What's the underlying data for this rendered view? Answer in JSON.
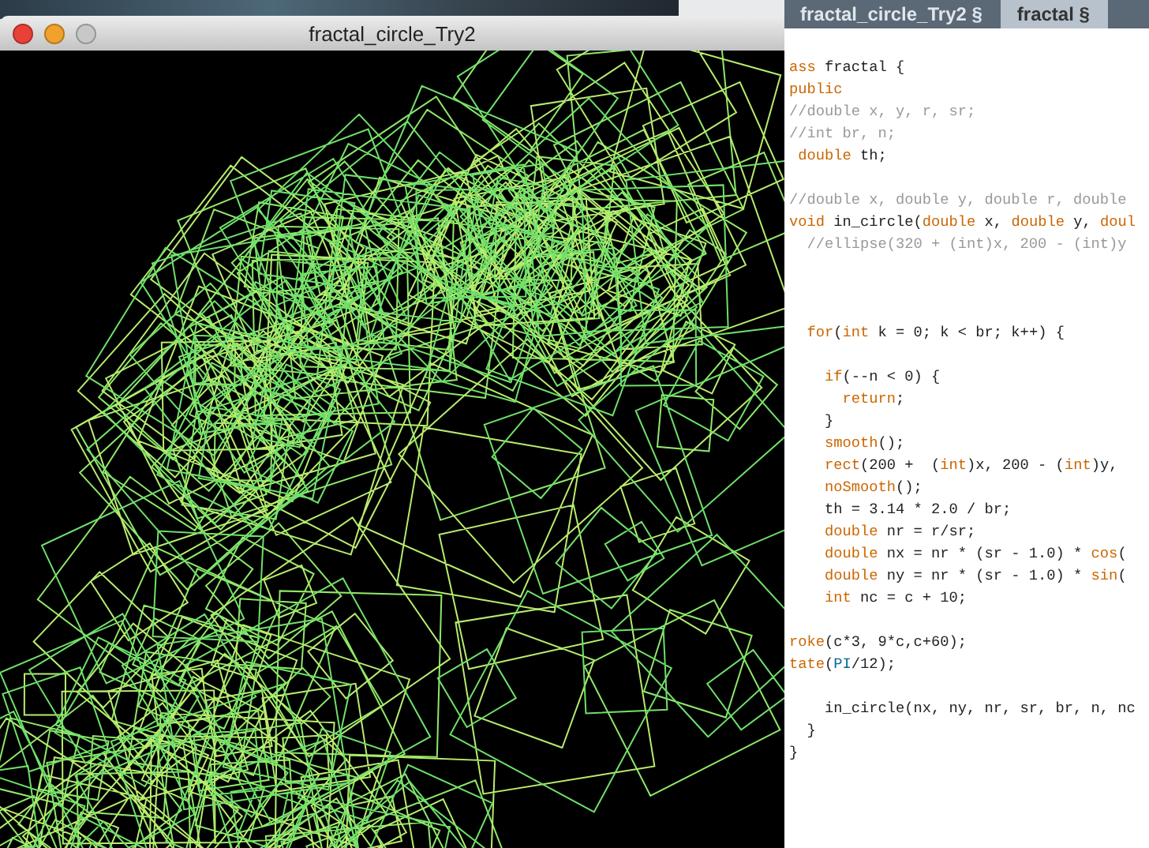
{
  "editor": {
    "tabs": [
      {
        "label": "fractal_circle_Try2 §",
        "selected": false
      },
      {
        "label": "fractal §",
        "selected": true
      }
    ],
    "lines": [
      {
        "kind": "code",
        "segments": [
          {
            "kind": "keyword",
            "text": "ass"
          },
          {
            "kind": "plain",
            "text": " fractal {"
          }
        ]
      },
      {
        "kind": "code",
        "segments": [
          {
            "kind": "keyword",
            "text": "public"
          }
        ]
      },
      {
        "kind": "code",
        "segments": [
          {
            "kind": "comment",
            "text": "//double x, y, r, sr;"
          }
        ]
      },
      {
        "kind": "code",
        "segments": [
          {
            "kind": "comment",
            "text": "//int br, n;"
          }
        ]
      },
      {
        "kind": "code",
        "segments": [
          {
            "kind": "keyword",
            "text": " double"
          },
          {
            "kind": "plain",
            "text": " th;"
          }
        ]
      },
      {
        "kind": "blank"
      },
      {
        "kind": "code",
        "segments": [
          {
            "kind": "comment",
            "text": "//double x, double y, double r, double"
          }
        ]
      },
      {
        "kind": "code",
        "segments": [
          {
            "kind": "keyword",
            "text": "void"
          },
          {
            "kind": "plain",
            "text": " in_circle("
          },
          {
            "kind": "keyword",
            "text": "double"
          },
          {
            "kind": "plain",
            "text": " x, "
          },
          {
            "kind": "keyword",
            "text": "double"
          },
          {
            "kind": "plain",
            "text": " y, "
          },
          {
            "kind": "keyword",
            "text": "doul"
          }
        ]
      },
      {
        "kind": "code",
        "segments": [
          {
            "kind": "comment",
            "text": "  //ellipse(320 + (int)x, 200 - (int)y"
          }
        ]
      },
      {
        "kind": "blank"
      },
      {
        "kind": "blank"
      },
      {
        "kind": "blank"
      },
      {
        "kind": "code",
        "segments": [
          {
            "kind": "keyword",
            "text": "  for"
          },
          {
            "kind": "plain",
            "text": "("
          },
          {
            "kind": "keyword",
            "text": "int"
          },
          {
            "kind": "plain",
            "text": " k = 0; k < br; k++) {"
          }
        ]
      },
      {
        "kind": "blank"
      },
      {
        "kind": "code",
        "segments": [
          {
            "kind": "keyword",
            "text": "    if"
          },
          {
            "kind": "plain",
            "text": "(--n < 0) {"
          }
        ]
      },
      {
        "kind": "code",
        "segments": [
          {
            "kind": "keyword",
            "text": "      return"
          },
          {
            "kind": "plain",
            "text": ";"
          }
        ]
      },
      {
        "kind": "code",
        "segments": [
          {
            "kind": "plain",
            "text": "    }"
          }
        ]
      },
      {
        "kind": "code",
        "segments": [
          {
            "kind": "function",
            "text": "    smooth"
          },
          {
            "kind": "plain",
            "text": "();"
          }
        ]
      },
      {
        "kind": "code",
        "segments": [
          {
            "kind": "function",
            "text": "    rect"
          },
          {
            "kind": "plain",
            "text": "(200 +  ("
          },
          {
            "kind": "keyword",
            "text": "int"
          },
          {
            "kind": "plain",
            "text": ")x, 200 - ("
          },
          {
            "kind": "keyword",
            "text": "int"
          },
          {
            "kind": "plain",
            "text": ")y,"
          }
        ]
      },
      {
        "kind": "code",
        "segments": [
          {
            "kind": "function",
            "text": "    noSmooth"
          },
          {
            "kind": "plain",
            "text": "();"
          }
        ]
      },
      {
        "kind": "code",
        "segments": [
          {
            "kind": "plain",
            "text": "    th = 3.14 * 2.0 / br;"
          }
        ]
      },
      {
        "kind": "code",
        "segments": [
          {
            "kind": "keyword",
            "text": "    double"
          },
          {
            "kind": "plain",
            "text": " nr = r/sr;"
          }
        ]
      },
      {
        "kind": "code",
        "segments": [
          {
            "kind": "keyword",
            "text": "    double"
          },
          {
            "kind": "plain",
            "text": " nx = nr * (sr - 1.0) * "
          },
          {
            "kind": "function",
            "text": "cos"
          },
          {
            "kind": "plain",
            "text": "("
          }
        ]
      },
      {
        "kind": "code",
        "segments": [
          {
            "kind": "keyword",
            "text": "    double"
          },
          {
            "kind": "plain",
            "text": " ny = nr * (sr - 1.0) * "
          },
          {
            "kind": "function",
            "text": "sin"
          },
          {
            "kind": "plain",
            "text": "("
          }
        ]
      },
      {
        "kind": "code",
        "segments": [
          {
            "kind": "keyword",
            "text": "    int"
          },
          {
            "kind": "plain",
            "text": " nc = c + 10;"
          }
        ]
      },
      {
        "kind": "blank"
      },
      {
        "kind": "code",
        "segments": [
          {
            "kind": "function",
            "text": "roke"
          },
          {
            "kind": "plain",
            "text": "(c*3, 9*c,c+60);"
          }
        ]
      },
      {
        "kind": "code",
        "segments": [
          {
            "kind": "function",
            "text": "tate"
          },
          {
            "kind": "plain",
            "text": "("
          },
          {
            "kind": "constant",
            "text": "PI"
          },
          {
            "kind": "plain",
            "text": "/12);"
          }
        ]
      },
      {
        "kind": "blank"
      },
      {
        "kind": "code",
        "segments": [
          {
            "kind": "plain",
            "text": "    in_circle(nx, ny, nr, sr, br, n, nc"
          }
        ]
      },
      {
        "kind": "code",
        "segments": [
          {
            "kind": "plain",
            "text": "  }"
          }
        ]
      },
      {
        "kind": "code",
        "segments": [
          {
            "kind": "plain",
            "text": "}"
          }
        ]
      }
    ]
  },
  "window": {
    "title": "fractal_circle_Try2",
    "buttons": [
      {
        "kind": "close",
        "disabled": false
      },
      {
        "kind": "minimize",
        "disabled": false
      },
      {
        "kind": "zoom",
        "disabled": true
      }
    ]
  }
}
